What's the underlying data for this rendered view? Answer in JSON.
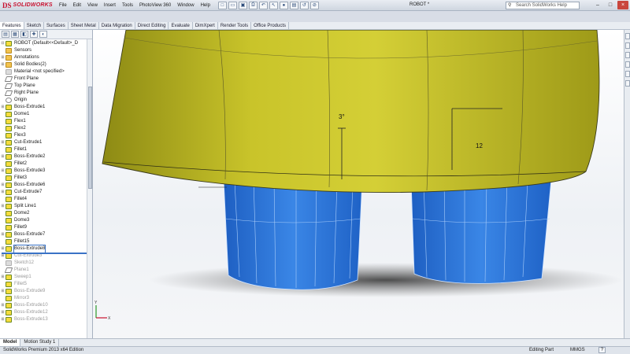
{
  "app": {
    "logo_prefix": "DS",
    "logo_text": "SOLIDWORKS",
    "document_title": "ROBOT *",
    "search_placeholder": "Search SolidWorks Help",
    "window_buttons": [
      "–",
      "□",
      "×"
    ]
  },
  "menu": [
    "File",
    "Edit",
    "View",
    "Insert",
    "Tools",
    "PhotoView 360",
    "Window",
    "Help"
  ],
  "command_tabs": [
    "Features",
    "Sketch",
    "Surfaces",
    "Sheet Metal",
    "Data Migration",
    "Direct Editing",
    "Evaluate",
    "DimXpert",
    "Render Tools",
    "Office Products"
  ],
  "feature_tree": {
    "root": "ROBOT  (Default<<Default>_D",
    "items": [
      {
        "label": "Sensors",
        "icon": "folder-icon",
        "expand": false
      },
      {
        "label": "Annotations",
        "icon": "folder-icon",
        "expand": true
      },
      {
        "label": "Solid Bodies(2)",
        "icon": "folder-icon",
        "expand": true
      },
      {
        "label": "Material <not specified>",
        "icon": "material-icon",
        "expand": false
      },
      {
        "label": "Front Plane",
        "icon": "plane-icon",
        "expand": false
      },
      {
        "label": "Top Plane",
        "icon": "plane-icon",
        "expand": false
      },
      {
        "label": "Right Plane",
        "icon": "plane-icon",
        "expand": false
      },
      {
        "label": "Origin",
        "icon": "origin-icon",
        "expand": false
      },
      {
        "label": "Boss-Extrude1",
        "icon": "feature-icon",
        "expand": true
      },
      {
        "label": "Dome1",
        "icon": "feature-icon",
        "expand": false
      },
      {
        "label": "Flex1",
        "icon": "feature-icon",
        "expand": false
      },
      {
        "label": "Flex2",
        "icon": "feature-icon",
        "expand": false
      },
      {
        "label": "Flex3",
        "icon": "feature-icon",
        "expand": false
      },
      {
        "label": "Cut-Extrude1",
        "icon": "feature-icon",
        "expand": true
      },
      {
        "label": "Fillet1",
        "icon": "feature-icon",
        "expand": false
      },
      {
        "label": "Boss-Extrude2",
        "icon": "feature-icon",
        "expand": true
      },
      {
        "label": "Fillet2",
        "icon": "feature-icon",
        "expand": false
      },
      {
        "label": "Boss-Extrude3",
        "icon": "feature-icon",
        "expand": true
      },
      {
        "label": "Fillet3",
        "icon": "feature-icon",
        "expand": false
      },
      {
        "label": "Boss-Extrude6",
        "icon": "feature-icon",
        "expand": true
      },
      {
        "label": "Cut-Extrude7",
        "icon": "feature-icon",
        "expand": true
      },
      {
        "label": "Fillet4",
        "icon": "feature-icon",
        "expand": false
      },
      {
        "label": "Split Line1",
        "icon": "feature-icon",
        "expand": true
      },
      {
        "label": "Dome2",
        "icon": "feature-icon",
        "expand": false
      },
      {
        "label": "Dome3",
        "icon": "feature-icon",
        "expand": false
      },
      {
        "label": "Fillet9",
        "icon": "feature-icon",
        "expand": false
      },
      {
        "label": "Boss-Extrude7",
        "icon": "feature-icon",
        "expand": true
      },
      {
        "label": "Fillet15",
        "icon": "feature-icon",
        "expand": false
      },
      {
        "label": "Boss-Extrude8",
        "icon": "feature-icon",
        "expand": true,
        "selected": true
      },
      {
        "label": "Cut-Extrude3",
        "icon": "feature-icon",
        "expand": true,
        "greyed": true
      },
      {
        "label": "Sketch12",
        "icon": "sketch-icon",
        "expand": false,
        "greyed": true
      },
      {
        "label": "Plane1",
        "icon": "plane-icon",
        "expand": false,
        "greyed": true
      },
      {
        "label": "Sweep1",
        "icon": "feature-icon",
        "expand": true,
        "greyed": true
      },
      {
        "label": "Fillet5",
        "icon": "feature-icon",
        "expand": false,
        "greyed": true
      },
      {
        "label": "Boss-Extrude9",
        "icon": "feature-icon",
        "expand": true,
        "greyed": true
      },
      {
        "label": "Mirror3",
        "icon": "feature-icon",
        "expand": false,
        "greyed": true
      },
      {
        "label": "Boss-Extrude10",
        "icon": "feature-icon",
        "expand": true,
        "greyed": true
      },
      {
        "label": "Boss-Extrude12",
        "icon": "feature-icon",
        "expand": true,
        "greyed": true
      },
      {
        "label": "Boss-Extrude13",
        "icon": "feature-icon",
        "expand": true,
        "greyed": true
      }
    ]
  },
  "viewport": {
    "dimension_angle": "3°",
    "dimension_length": "12",
    "dome_color": "#b9b41a",
    "leg_color": "#2a72d8",
    "triad_x": "X",
    "triad_y": "Y"
  },
  "bottom_tabs": [
    "Model",
    "Motion Study 1"
  ],
  "status": {
    "edition": "SolidWorks Premium 2013 x64 Edition",
    "mode": "Editing Part",
    "units": "MMGS",
    "help": "?"
  }
}
